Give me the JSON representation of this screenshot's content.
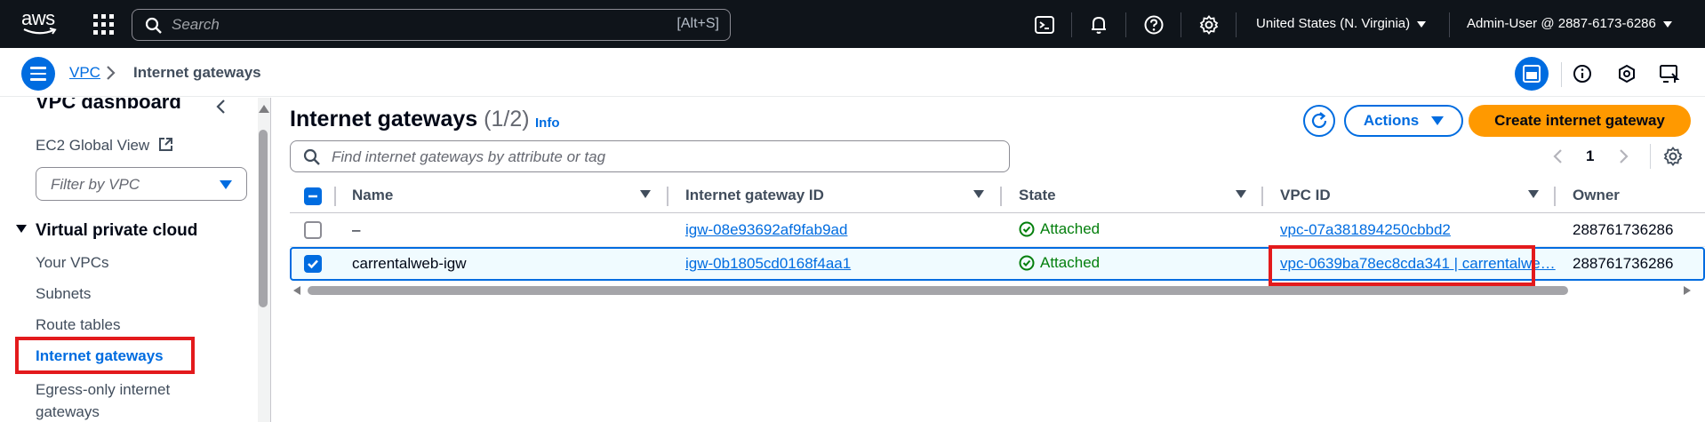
{
  "topnav": {
    "logo_text": "aws",
    "search_placeholder": "Search",
    "search_shortcut": "[Alt+S]",
    "region": "United States (N. Virginia)",
    "account": "Admin-User @ 2887-6173-6286"
  },
  "breadcrumb": {
    "parent": "VPC",
    "current": "Internet gateways"
  },
  "sidebar": {
    "title": "VPC dashboard",
    "global_view": "EC2 Global View",
    "filter_placeholder": "Filter by VPC",
    "section": "Virtual private cloud",
    "items": [
      {
        "label": "Your VPCs"
      },
      {
        "label": "Subnets"
      },
      {
        "label": "Route tables"
      },
      {
        "label": "Internet gateways"
      },
      {
        "label": "Egress-only internet gateways"
      }
    ]
  },
  "main": {
    "title": "Internet gateways",
    "count": "(1/2)",
    "info": "Info",
    "actions_label": "Actions",
    "create_label": "Create internet gateway",
    "search_placeholder": "Find internet gateways by attribute or tag",
    "page": "1",
    "columns": [
      "Name",
      "Internet gateway ID",
      "State",
      "VPC ID",
      "Owner"
    ],
    "rows": [
      {
        "name": "–",
        "igw_id": "igw-08e93692af9fab9ad",
        "state": "Attached",
        "vpc_id": "vpc-07a381894250cbbd2",
        "owner": "288761736286",
        "selected": false
      },
      {
        "name": "carrentalweb-igw",
        "igw_id": "igw-0b1805cd0168f4aa1",
        "state": "Attached",
        "vpc_id": "vpc-0639ba78ec8cda341 | carrentalwe…",
        "owner": "288761736286",
        "selected": true
      }
    ]
  },
  "colors": {
    "accent": "#006ce0",
    "nav_bg": "#0f141a",
    "primary_button": "#ff9900",
    "success": "#037f0c",
    "highlight_box": "#e31a1c"
  }
}
